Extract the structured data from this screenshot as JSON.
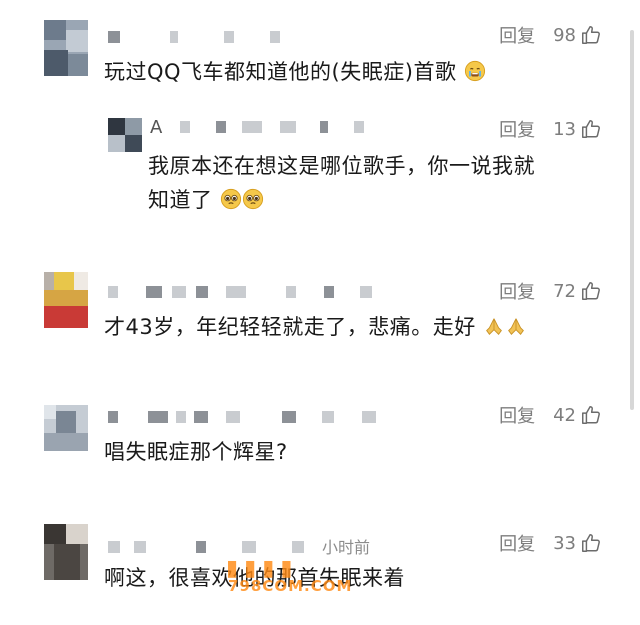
{
  "comments": [
    {
      "text": "玩过QQ飞车都知道他的(失眠症)首歌",
      "reply_label": "回复",
      "likes": "98",
      "reply": {
        "nick_initial": "A",
        "text_line1": "我原本还在想这是哪位歌手，你一说我就",
        "text_line2": "知道了",
        "reply_label": "回复",
        "likes": "13"
      }
    },
    {
      "text": "才43岁，年纪轻轻就走了，悲痛。走好",
      "reply_label": "回复",
      "likes": "72"
    },
    {
      "text": "唱失眠症那个辉星?",
      "reply_label": "回复",
      "likes": "42"
    },
    {
      "text": "啊这，很喜欢他的那首失眠来着",
      "time": "小时前",
      "reply_label": "回复",
      "likes": "33"
    }
  ],
  "watermark": {
    "url": "798COM.COM"
  },
  "colors": {
    "meta_gray": "#7d7d7d",
    "text": "#1a1a1a",
    "watermark": "#ff8a14"
  },
  "icons": [
    "thumbs-up-icon",
    "crying-face-emoji",
    "pleading-face-emoji",
    "folded-hands-emoji"
  ]
}
